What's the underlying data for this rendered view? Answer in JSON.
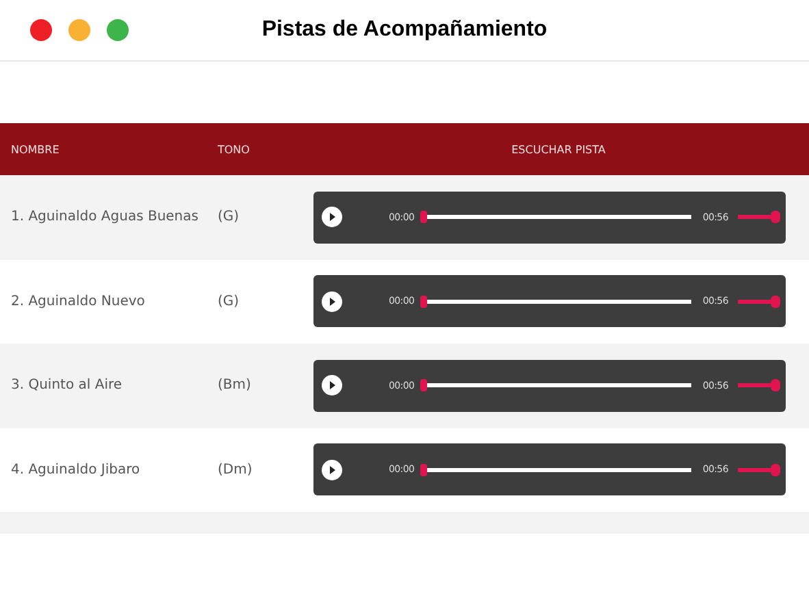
{
  "window": {
    "title": "Pistas de Acompañamiento"
  },
  "table": {
    "columns": [
      "NOMBRE",
      "TONO",
      "ESCUCHAR PISTA"
    ],
    "rows": [
      {
        "name": "1. Aguinaldo Aguas Buenas",
        "key": "(G)",
        "player": {
          "current": "00:00",
          "duration": "00:56",
          "progress": {
            "level": 0
          },
          "volume": {
            "level": 1
          }
        }
      },
      {
        "name": "2. Aguinaldo Nuevo",
        "key": "(G)",
        "player": {
          "current": "00:00",
          "duration": "00:56",
          "progress": {
            "level": 0
          },
          "volume": {
            "level": 1
          }
        }
      },
      {
        "name": "3. Quinto al Aire",
        "key": "(Bm)",
        "player": {
          "current": "00:00",
          "duration": "00:56",
          "progress": {
            "level": 0
          },
          "volume": {
            "level": 1
          }
        }
      },
      {
        "name": "4. Aguinaldo Jibaro",
        "key": "(Dm)",
        "player": {
          "current": "00:00",
          "duration": "00:56",
          "progress": {
            "level": 0
          },
          "volume": {
            "level": 1
          }
        }
      }
    ]
  }
}
